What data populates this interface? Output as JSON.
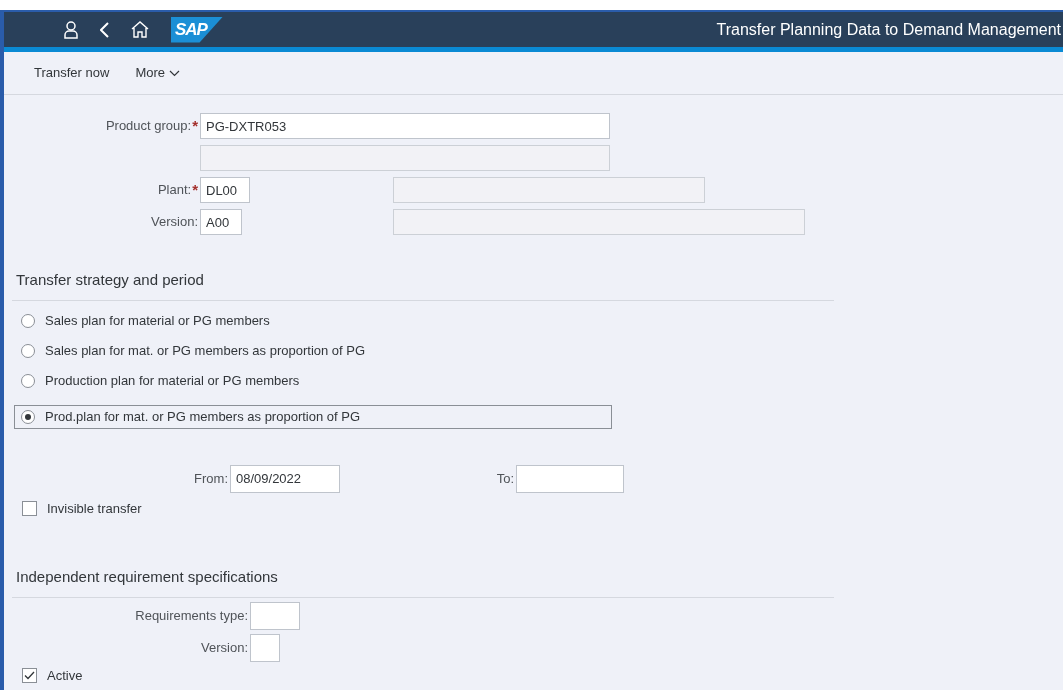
{
  "shell": {
    "logo": "SAP",
    "title": "Transfer Planning Data to Demand Management"
  },
  "toolbar": [
    {
      "label": "Transfer now",
      "kind": "button"
    },
    {
      "label": "More",
      "kind": "menu"
    }
  ],
  "header_fields": [
    {
      "label": "Product group:",
      "required_mark": "*",
      "value": "PG-DXTR053",
      "kind": "stacked"
    },
    {
      "label": "Plant:",
      "required_mark": "*",
      "value": "DL00",
      "kind": "inline"
    },
    {
      "label": "Version:",
      "value": "A00",
      "kind": "inline"
    }
  ],
  "strategy_section": {
    "title": "Transfer strategy and period",
    "options": [
      {
        "label": "Sales plan for material or PG members",
        "selected": false
      },
      {
        "label": "Sales plan for mat. or PG members as proportion of PG",
        "selected": false
      },
      {
        "label": "Production plan for material or PG members",
        "selected": false
      },
      {
        "label": "Prod.plan for mat. or PG members as proportion of PG",
        "selected": true
      }
    ],
    "from": {
      "label": "From:",
      "value": "08/09/2022"
    },
    "to": {
      "label": "To:"
    },
    "invisible_transfer": {
      "label": "Invisible transfer",
      "checked": false
    }
  },
  "requirements_section": {
    "title": "Independent requirement specifications",
    "fields": [
      {
        "label": "Requirements type:"
      },
      {
        "label": "Version:"
      }
    ],
    "active": {
      "label": "Active",
      "checked": true
    }
  }
}
